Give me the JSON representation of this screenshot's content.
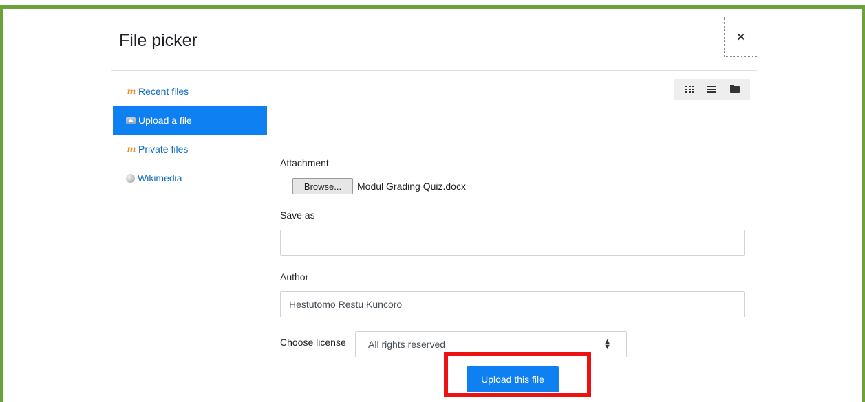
{
  "dialog": {
    "title": "File picker",
    "close_label": "×"
  },
  "sidebar": {
    "items": [
      {
        "label": "Recent files",
        "icon": "moodle-icon",
        "active": false
      },
      {
        "label": "Upload a file",
        "icon": "upload-icon",
        "active": true
      },
      {
        "label": "Private files",
        "icon": "moodle-icon",
        "active": false
      },
      {
        "label": "Wikimedia",
        "icon": "wikimedia-globe-icon",
        "active": false
      }
    ]
  },
  "toolbar": {
    "views": [
      "grid-view-icon",
      "list-view-icon",
      "folder-view-icon"
    ]
  },
  "form": {
    "attachment_label": "Attachment",
    "browse_label": "Browse...",
    "file_name": "Modul Grading Quiz.docx",
    "save_as_label": "Save as",
    "save_as_value": "",
    "author_label": "Author",
    "author_value": "Hestutomo Restu Kuncoro",
    "license_label": "Choose license",
    "license_value": "All rights reserved",
    "upload_label": "Upload this file"
  },
  "colors": {
    "frame_border": "#6ba23a",
    "accent": "#0f80f2",
    "link": "#0f6cbf",
    "highlight": "#ee1111"
  }
}
